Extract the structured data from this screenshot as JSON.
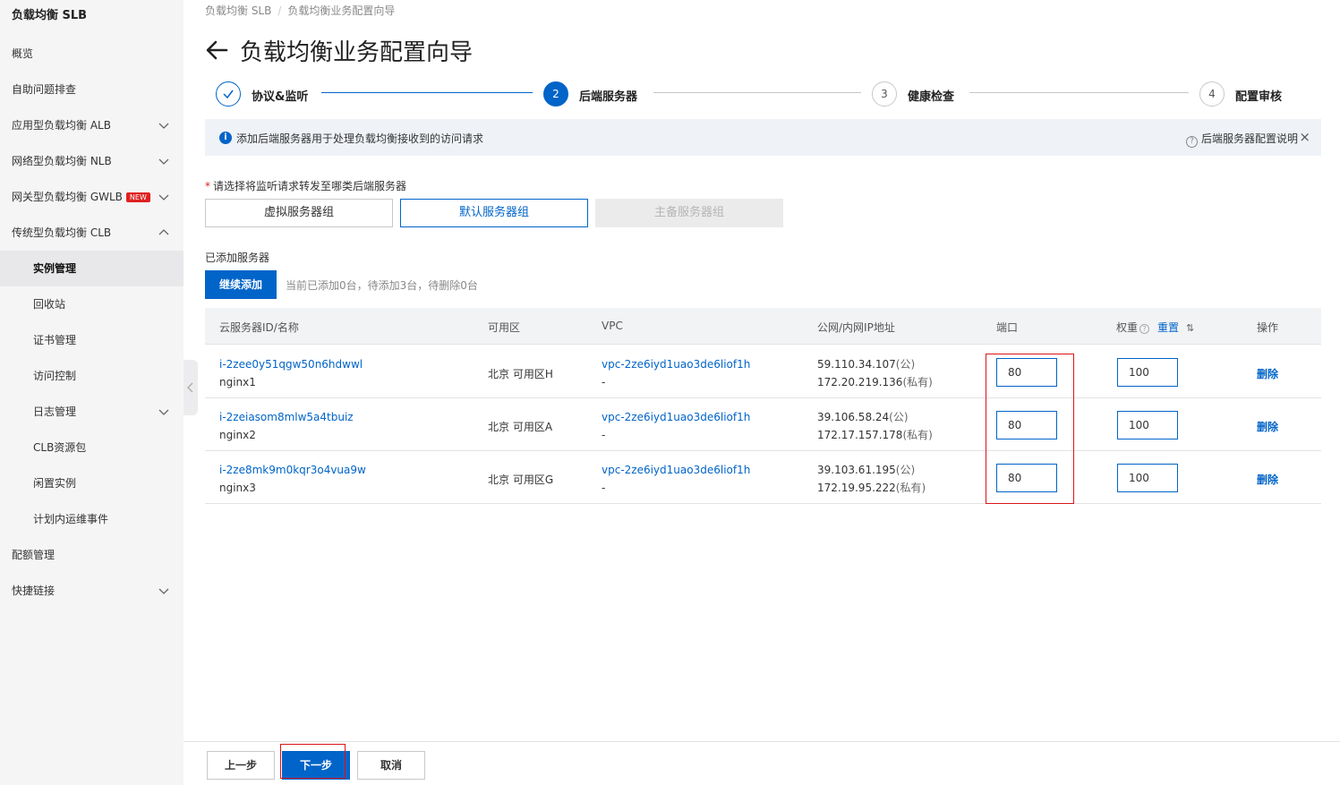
{
  "sidebar": {
    "title": "负载均衡 SLB",
    "items": [
      {
        "label": "概览"
      },
      {
        "label": "自助问题排查"
      },
      {
        "label": "应用型负载均衡 ALB"
      },
      {
        "label": "网络型负载均衡 NLB"
      },
      {
        "label": "网关型负载均衡 GWLB",
        "badge": "NEW"
      },
      {
        "label": "传统型负载均衡 CLB"
      },
      {
        "label": "实例管理"
      },
      {
        "label": "回收站"
      },
      {
        "label": "证书管理"
      },
      {
        "label": "访问控制"
      },
      {
        "label": "日志管理"
      },
      {
        "label": "CLB资源包"
      },
      {
        "label": "闲置实例"
      },
      {
        "label": "计划内运维事件"
      },
      {
        "label": "配额管理"
      },
      {
        "label": "快捷链接"
      }
    ]
  },
  "breadcrumb": [
    "负载均衡 SLB",
    "负载均衡业务配置向导"
  ],
  "page_title": "负载均衡业务配置向导",
  "steps": [
    {
      "num": "",
      "label": "协议&监听",
      "state": "done"
    },
    {
      "num": "2",
      "label": "后端服务器",
      "state": "active"
    },
    {
      "num": "3",
      "label": "健康检查",
      "state": "pending"
    },
    {
      "num": "4",
      "label": "配置审核",
      "state": "pending"
    }
  ],
  "notice": {
    "icon": "i",
    "text": "添加后端服务器用于处理负载均衡接收到的访问请求",
    "help_icon": "?",
    "help_text": "后端服务器配置说明",
    "close": "×"
  },
  "server_type": {
    "required_mark": "*",
    "label": "请选择将监听请求转发至哪类后端服务器",
    "options": [
      "虚拟服务器组",
      "默认服务器组",
      "主备服务器组"
    ],
    "selected": "默认服务器组"
  },
  "added_servers": {
    "label": "已添加服务器",
    "add_button": "继续添加",
    "status": "当前已添加0台，待添加3台，待删除0台"
  },
  "table": {
    "headers": {
      "id": "云服务器ID/名称",
      "zone": "可用区",
      "vpc": "VPC",
      "ip": "公网/内网IP地址",
      "port": "端口",
      "weight": "权重",
      "weight_help": "?",
      "reset": "重置",
      "sort": "⇅",
      "actions": "操作"
    },
    "rows": [
      {
        "id": "i-2zee0y51qgw50n6hdwwl",
        "name": "nginx1",
        "zone": "北京 可用区H",
        "vpc": "vpc-2ze6iyd1uao3de6liof1h",
        "vpc_sub": "-",
        "public_ip": "59.110.34.107",
        "public_tag": "(公)",
        "private_ip": "172.20.219.136",
        "private_tag": "(私有)",
        "port": "80",
        "weight": "100",
        "action": "删除"
      },
      {
        "id": "i-2zeiasom8mlw5a4tbuiz",
        "name": "nginx2",
        "zone": "北京 可用区A",
        "vpc": "vpc-2ze6iyd1uao3de6liof1h",
        "vpc_sub": "-",
        "public_ip": "39.106.58.24",
        "public_tag": "(公)",
        "private_ip": "172.17.157.178",
        "private_tag": "(私有)",
        "port": "80",
        "weight": "100",
        "action": "删除"
      },
      {
        "id": "i-2ze8mk9m0kqr3o4vua9w",
        "name": "nginx3",
        "zone": "北京 可用区G",
        "vpc": "vpc-2ze6iyd1uao3de6liof1h",
        "vpc_sub": "-",
        "public_ip": "39.103.61.195",
        "public_tag": "(公)",
        "private_ip": "172.19.95.222",
        "private_tag": "(私有)",
        "port": "80",
        "weight": "100",
        "action": "删除"
      }
    ]
  },
  "footer": {
    "prev": "上一步",
    "next": "下一步",
    "cancel": "取消"
  },
  "colors": {
    "primary": "#0064c8",
    "highlight": "#d9141b",
    "new_badge": "#e02020"
  }
}
